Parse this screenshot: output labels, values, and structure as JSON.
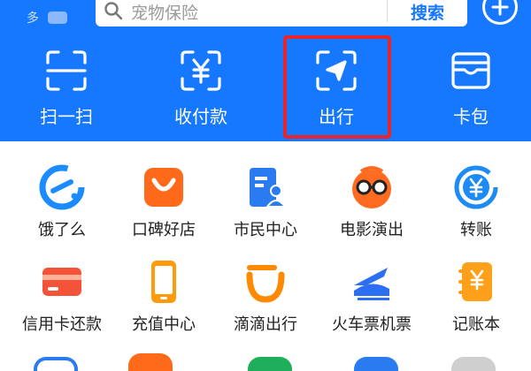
{
  "search": {
    "placeholder": "宠物保险",
    "button_label": "搜索"
  },
  "top_left": {
    "text": "多"
  },
  "quick_actions": [
    {
      "label": "扫一扫",
      "icon": "scan-icon"
    },
    {
      "label": "收付款",
      "icon": "payment-icon"
    },
    {
      "label": "出行",
      "icon": "travel-icon",
      "highlighted": true
    },
    {
      "label": "卡包",
      "icon": "wallet-icon"
    }
  ],
  "apps_row1": [
    {
      "label": "饿了么",
      "icon": "eleme-icon"
    },
    {
      "label": "口碑好店",
      "icon": "koubei-icon"
    },
    {
      "label": "市民中心",
      "icon": "citizen-center-icon"
    },
    {
      "label": "电影演出",
      "icon": "movie-icon"
    },
    {
      "label": "转账",
      "icon": "transfer-icon"
    }
  ],
  "apps_row2": [
    {
      "label": "信用卡还款",
      "icon": "credit-card-icon"
    },
    {
      "label": "充值中心",
      "icon": "phone-recharge-icon"
    },
    {
      "label": "滴滴出行",
      "icon": "didi-icon"
    },
    {
      "label": "火车票机票",
      "icon": "train-plane-icon"
    },
    {
      "label": "记账本",
      "icon": "ledger-icon"
    }
  ],
  "colors": {
    "brand_blue": "#1677ff",
    "highlight_red": "#e8252b",
    "eleme_blue": "#1a8cff",
    "koubei_orange": "#ff6a1a",
    "citizen_blue": "#2b7bf0",
    "movie_orange": "#ff6b20",
    "transfer_blue": "#1c8bf6",
    "credit_red": "#f4533a",
    "recharge_orange": "#ff9b0a",
    "didi_orange": "#ff8a00",
    "train_blue": "#2d6ff3",
    "ledger_orange": "#ffa01a"
  }
}
